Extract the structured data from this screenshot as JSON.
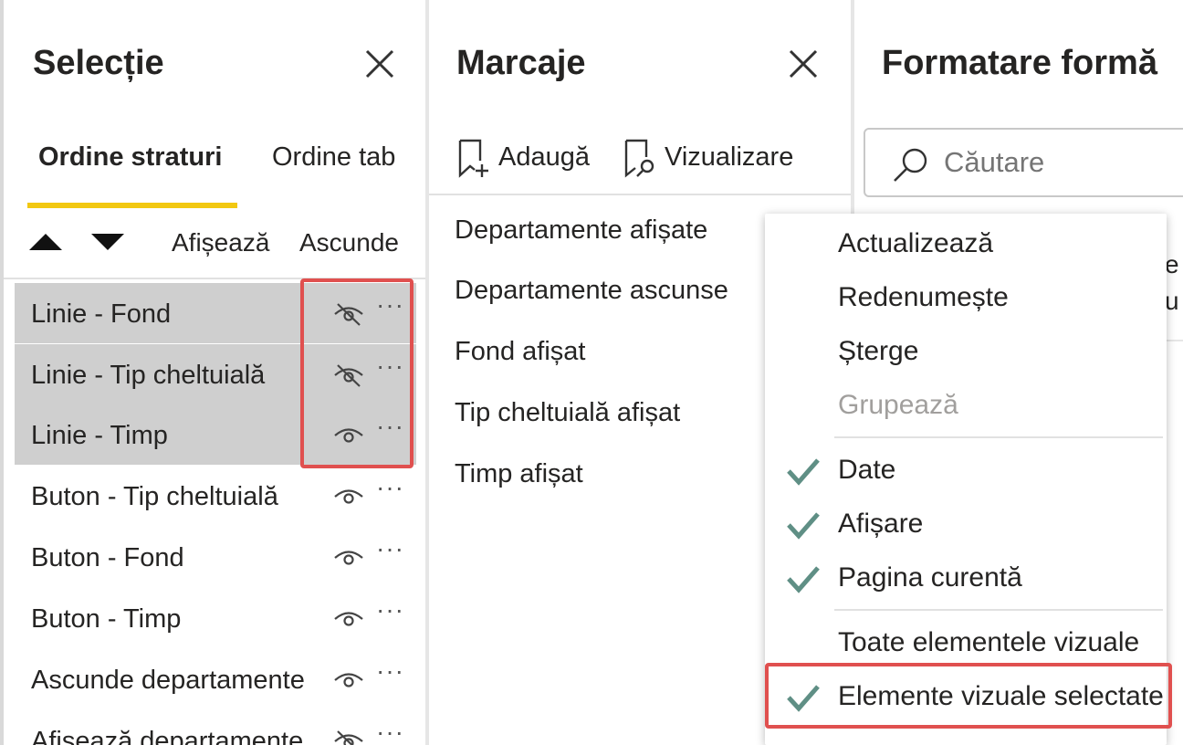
{
  "selection": {
    "title": "Selecție",
    "tabs": {
      "layer_order": "Ordine straturi",
      "tab_order": "Ordine tab"
    },
    "show_all": "Afișează",
    "hide_all": "Ascunde",
    "layers": [
      {
        "label": "Linie - Fond",
        "visible": false,
        "selected": true
      },
      {
        "label": "Linie - Tip cheltuială",
        "visible": false,
        "selected": true
      },
      {
        "label": "Linie - Timp",
        "visible": true,
        "selected": true
      },
      {
        "label": "Buton - Tip cheltuială",
        "visible": true,
        "selected": false
      },
      {
        "label": "Buton - Fond",
        "visible": true,
        "selected": false
      },
      {
        "label": "Buton - Timp",
        "visible": true,
        "selected": false
      },
      {
        "label": "Ascunde departamente",
        "visible": true,
        "selected": false
      },
      {
        "label": "Afișează departamente",
        "visible": false,
        "selected": false
      }
    ]
  },
  "bookmarks": {
    "title": "Marcaje",
    "add_label": "Adaugă",
    "view_label": "Vizualizare",
    "items": [
      "Departamente afișate",
      "Departamente ascunse",
      "Fond afișat",
      "Tip cheltuială afișat",
      "Timp afișat"
    ]
  },
  "format": {
    "title": "Formatare formă",
    "search_placeholder": "Căutare",
    "fragment_1": "e",
    "fragment_2": "u"
  },
  "context_menu": {
    "items": [
      {
        "label": "Actualizează",
        "checked": false,
        "disabled": false
      },
      {
        "label": "Redenumește",
        "checked": false,
        "disabled": false
      },
      {
        "label": "Șterge",
        "checked": false,
        "disabled": false
      },
      {
        "label": "Grupează",
        "checked": false,
        "disabled": true
      },
      {
        "label": "Date",
        "checked": true,
        "disabled": false
      },
      {
        "label": "Afișare",
        "checked": true,
        "disabled": false
      },
      {
        "label": "Pagina curentă",
        "checked": true,
        "disabled": false
      },
      {
        "label": "Toate elementele vizuale",
        "checked": false,
        "disabled": false
      },
      {
        "label": "Elemente vizuale selectate",
        "checked": true,
        "disabled": false
      }
    ]
  },
  "colors": {
    "accent_underline": "#f2c811",
    "highlight_border": "#e0504f",
    "checkmark": "#5f8f85",
    "selected_row": "#cfcfcf"
  },
  "icons": {
    "close": "close-icon",
    "move_up": "triangle-up-icon",
    "move_down": "triangle-down-icon",
    "visible": "eye-icon",
    "hidden": "eye-slash-icon",
    "more": "more-options-icon",
    "add_bookmark": "bookmark-add-icon",
    "view_bookmark": "bookmark-view-icon",
    "search": "search-icon",
    "check": "checkmark-icon"
  }
}
